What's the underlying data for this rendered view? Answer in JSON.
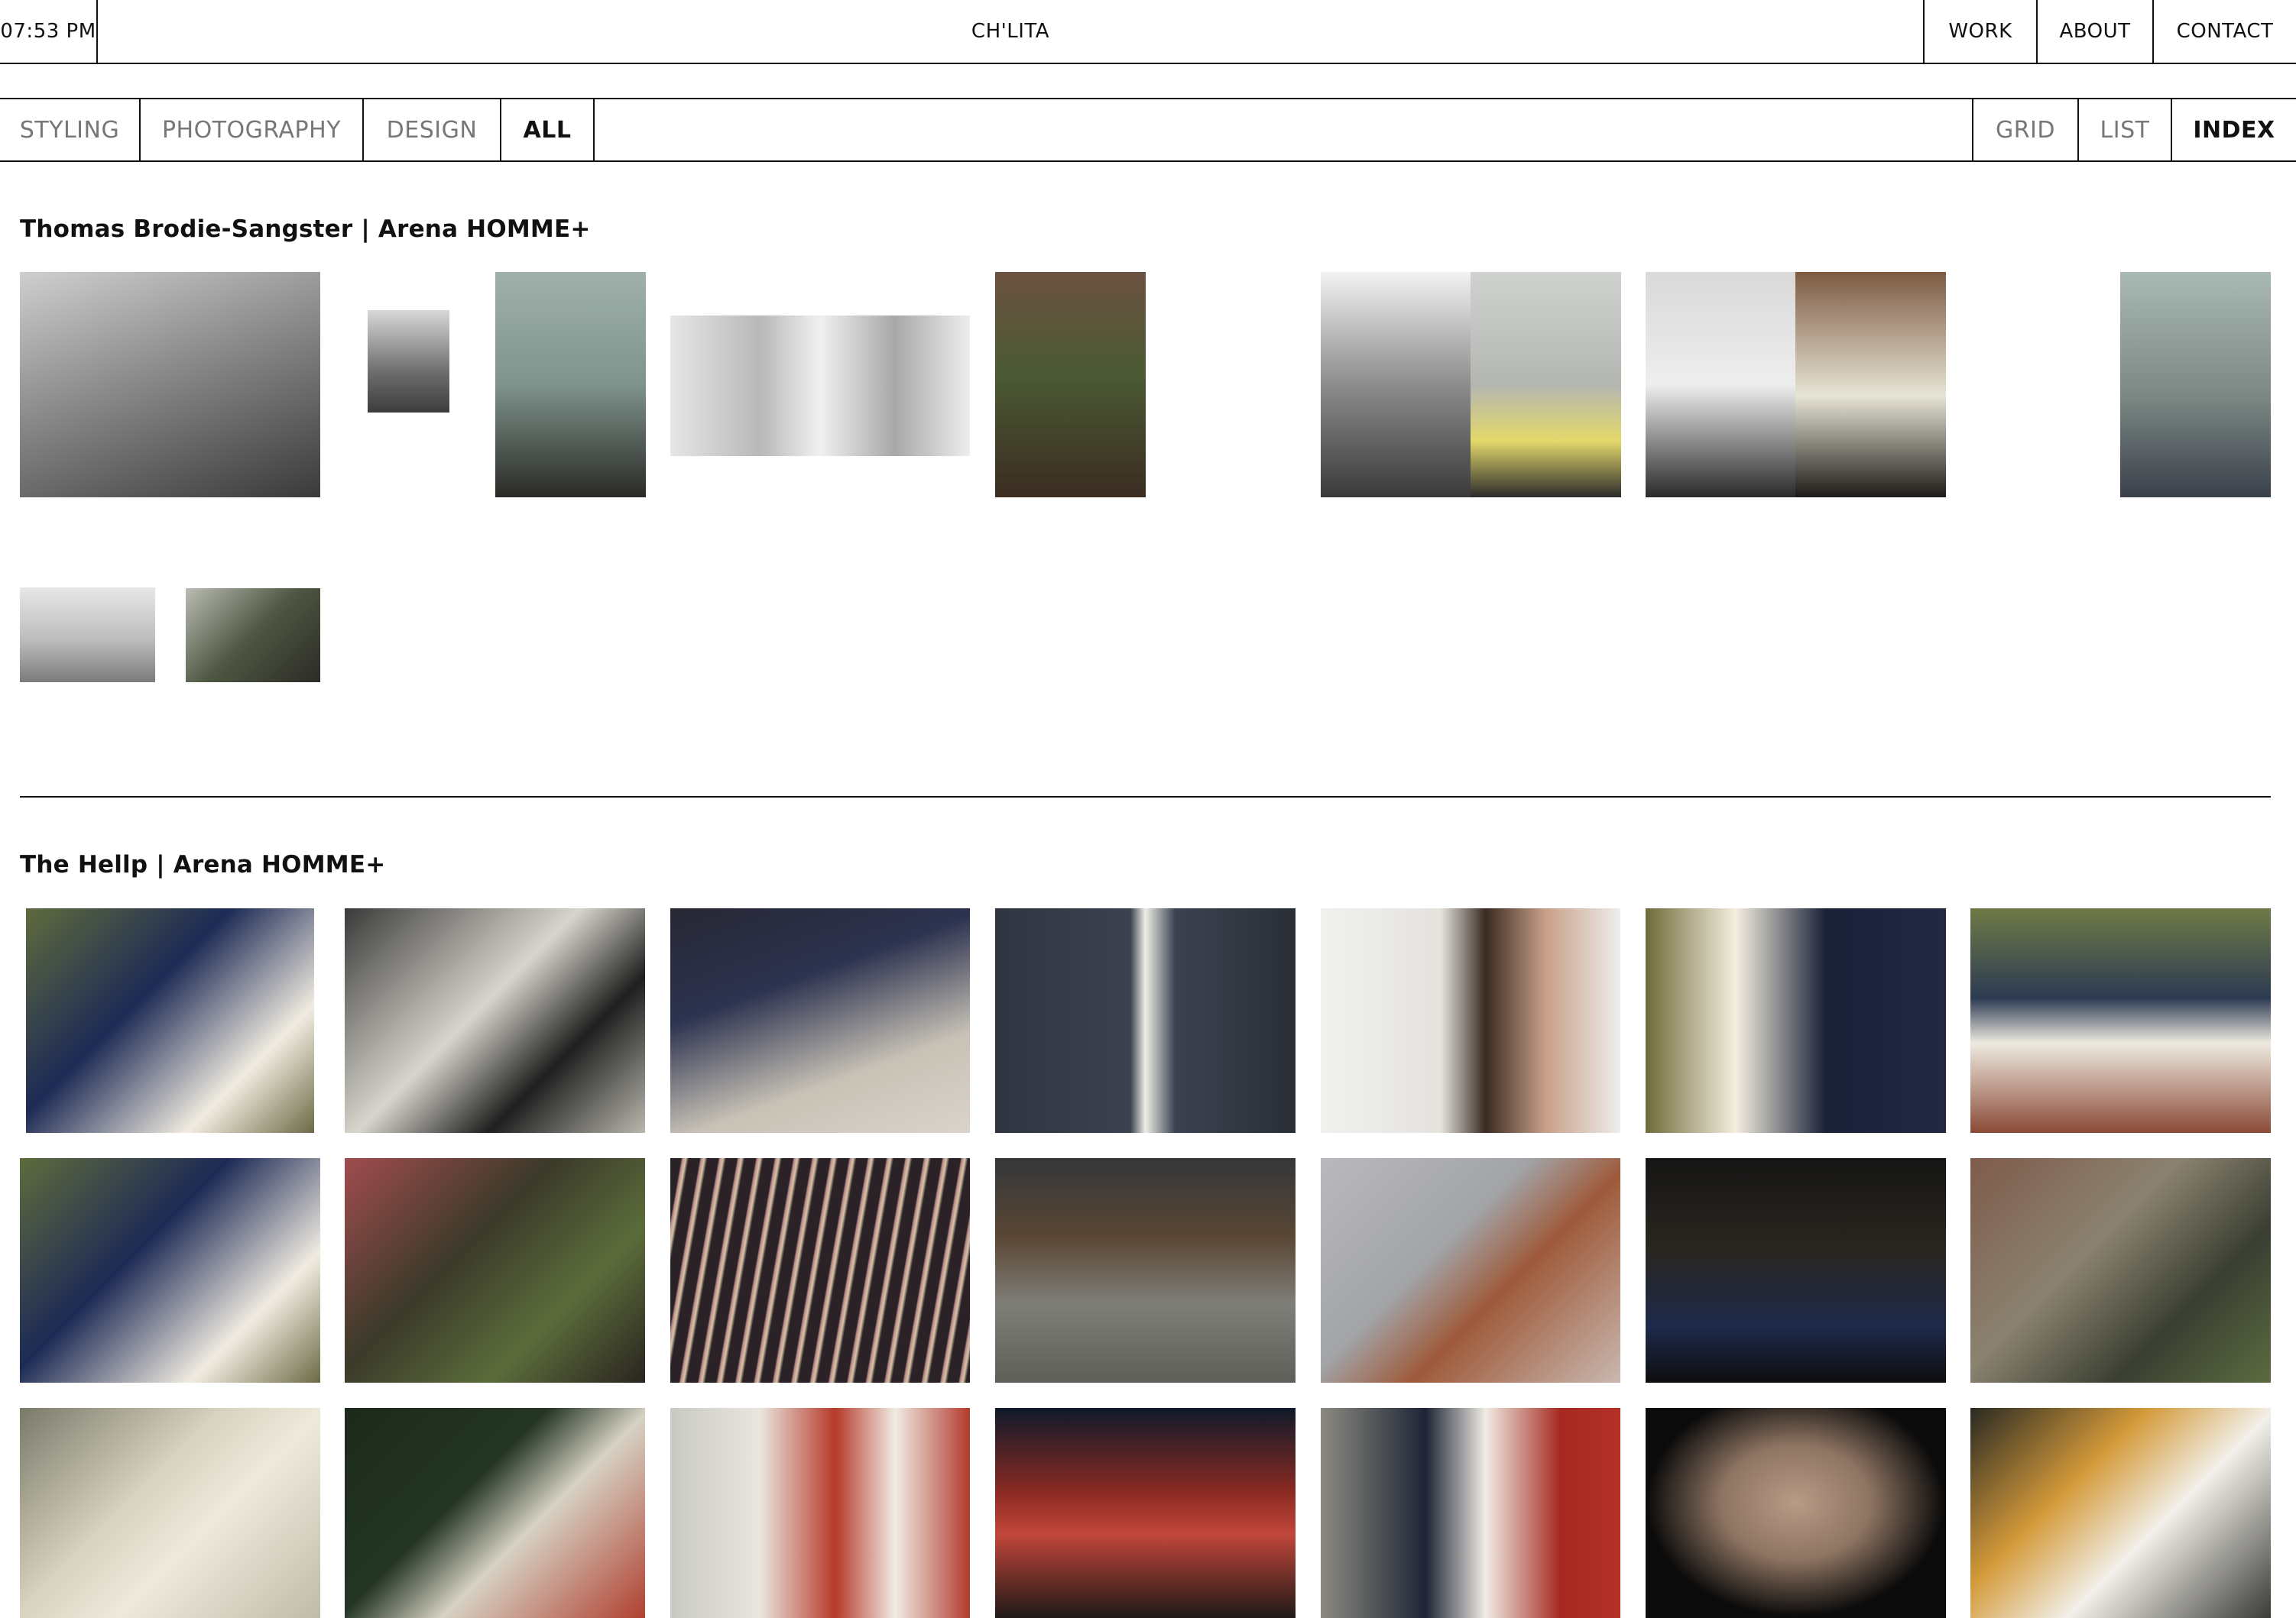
{
  "header": {
    "clock": "07:53 PM",
    "site_title": "CH'LITA",
    "nav": [
      "WORK",
      "ABOUT",
      "CONTACT"
    ]
  },
  "filters": {
    "categories": [
      "STYLING",
      "PHOTOGRAPHY",
      "DESIGN",
      "ALL"
    ],
    "active_category": "ALL",
    "views": [
      "GRID",
      "LIST",
      "INDEX"
    ],
    "active_view": "INDEX"
  },
  "projects": [
    {
      "title": "Thomas Brodie-Sangster | Arena HOMME+",
      "photo_count": 13
    },
    {
      "title": "The Hellp | Arena HOMME+",
      "photo_count": 21
    }
  ],
  "colors": {
    "rule": "#111111",
    "text": "#111111",
    "inactive_text": "#777777",
    "background": "#ffffff"
  }
}
